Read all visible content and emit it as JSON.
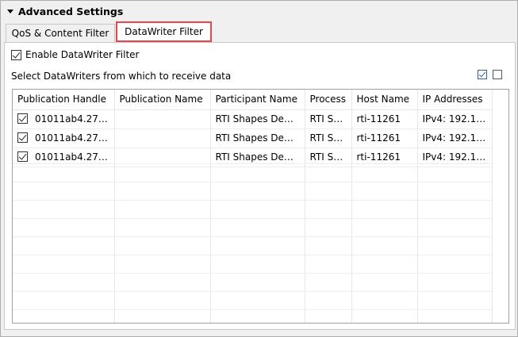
{
  "section": {
    "title": "Advanced Settings"
  },
  "tabs": [
    {
      "label": "QoS & Content Filter",
      "active": false
    },
    {
      "label": "DataWriter Filter",
      "active": true
    }
  ],
  "filter": {
    "enable_label": "Enable DataWriter Filter",
    "enable_checked": true,
    "select_label": "Select DataWriters from which to receive data"
  },
  "table": {
    "columns": [
      "Publication Handle",
      "Publication Name",
      "Participant Name",
      "Process",
      "Host Name",
      "IP Addresses"
    ],
    "rows": [
      {
        "checked": true,
        "handle": "01011ab4.27…",
        "pub_name": "",
        "participant": "RTI Shapes De…",
        "process": "RTI Sh…",
        "host": "rti-11261",
        "ip": "IPv4: 192.1…"
      },
      {
        "checked": true,
        "handle": "01011ab4.27…",
        "pub_name": "",
        "participant": "RTI Shapes De…",
        "process": "RTI Sh…",
        "host": "rti-11261",
        "ip": "IPv4: 192.1…"
      },
      {
        "checked": true,
        "handle": "01011ab4.27…",
        "pub_name": "",
        "participant": "RTI Shapes De…",
        "process": "RTI Sh…",
        "host": "rti-11261",
        "ip": "IPv4: 192.1…"
      }
    ]
  },
  "colors": {
    "highlight": "#e8464a",
    "icon_blue": "#2f5f9a"
  },
  "icons": [
    "collapse-triangle-icon",
    "check-all-icon",
    "uncheck-all-icon"
  ]
}
